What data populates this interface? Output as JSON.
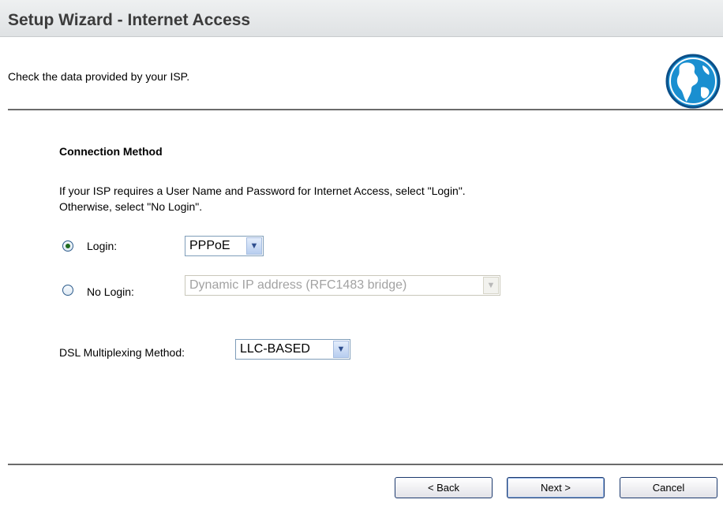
{
  "header": {
    "title": "Setup Wizard - Internet Access"
  },
  "subheader": {
    "text": "Check the data provided by your ISP.",
    "icon": "globe-icon"
  },
  "connection": {
    "section_title": "Connection Method",
    "info_line1": "If your ISP requires a User Name and Password for Internet Access, select \"Login\".",
    "info_line2": "Otherwise, select \"No Login\".",
    "login_label": "Login:",
    "login_selected": true,
    "login_type": "PPPoE",
    "nologin_label": "No Login:",
    "nologin_type": "Dynamic IP address (RFC1483 bridge)"
  },
  "dsl": {
    "label": "DSL Multiplexing Method:",
    "value": "LLC-BASED"
  },
  "footer": {
    "back_label": "< Back",
    "next_label": "Next >",
    "cancel_label": "Cancel"
  }
}
